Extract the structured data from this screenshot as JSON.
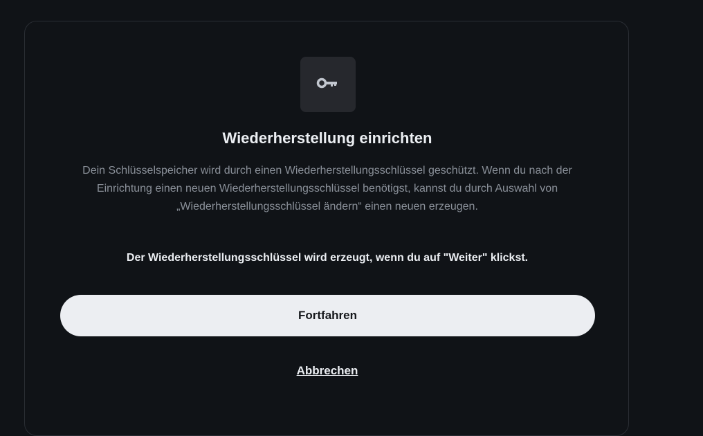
{
  "dialog": {
    "icon": "key-icon",
    "title": "Wiederherstellung einrichten",
    "description": "Dein Schlüsselspeicher wird durch einen Wiederherstellungsschlüssel geschützt. Wenn du nach der Einrichtung einen neuen Wiederherstellungsschlüssel benötigst, kannst du durch Auswahl von „Wiederherstellungsschlüssel ändern“ einen neuen erzeugen.",
    "note": "Der Wiederherstellungsschlüssel wird erzeugt, wenn du auf \"Weiter\" klickst.",
    "primary_button_label": "Fortfahren",
    "cancel_label": "Abbrechen"
  },
  "colors": {
    "background": "#101317",
    "card_border": "#2a2e34",
    "icon_box": "#26282d",
    "icon": "#c2c7cf",
    "title_text": "#ebeef2",
    "description_text": "#8a9099",
    "primary_button_bg": "#eceef2",
    "primary_button_text": "#15171b"
  }
}
